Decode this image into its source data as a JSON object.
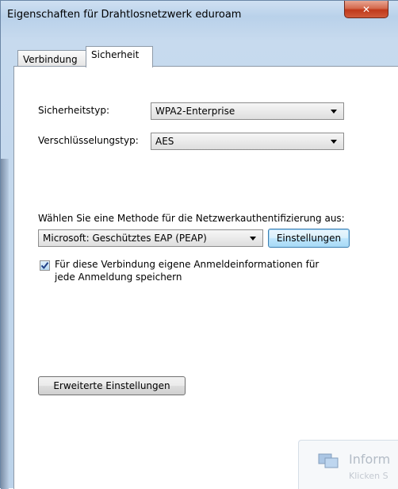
{
  "window": {
    "title": "Eigenschaften für Drahtlosnetzwerk eduroam",
    "close_glyph": "✕"
  },
  "tabs": [
    {
      "label": "Verbindung",
      "active": false
    },
    {
      "label": "Sicherheit",
      "active": true
    }
  ],
  "security": {
    "type_label": "Sicherheitstyp:",
    "type_value": "WPA2-Enterprise",
    "encryption_label": "Verschlüsselungstyp:",
    "encryption_value": "AES"
  },
  "auth": {
    "prompt_label": "Wählen Sie eine Methode für die Netzwerkauthentifizierung aus:",
    "method_value": "Microsoft: Geschütztes EAP (PEAP)",
    "settings_button": "Einstellungen",
    "remember_checked": true,
    "remember_label_line1": "Für diese Verbindung eigene Anmeldeinformationen für",
    "remember_label_line2": "jede Anmeldung speichern"
  },
  "advanced_button": "Erweiterte Einstellungen",
  "notification": {
    "title": "Inform",
    "subtitle": "Klicken S"
  },
  "colors": {
    "close_red": "#c0391b",
    "focus_blue": "#3c7fb1",
    "frame_blue": "#b9d1ea"
  }
}
